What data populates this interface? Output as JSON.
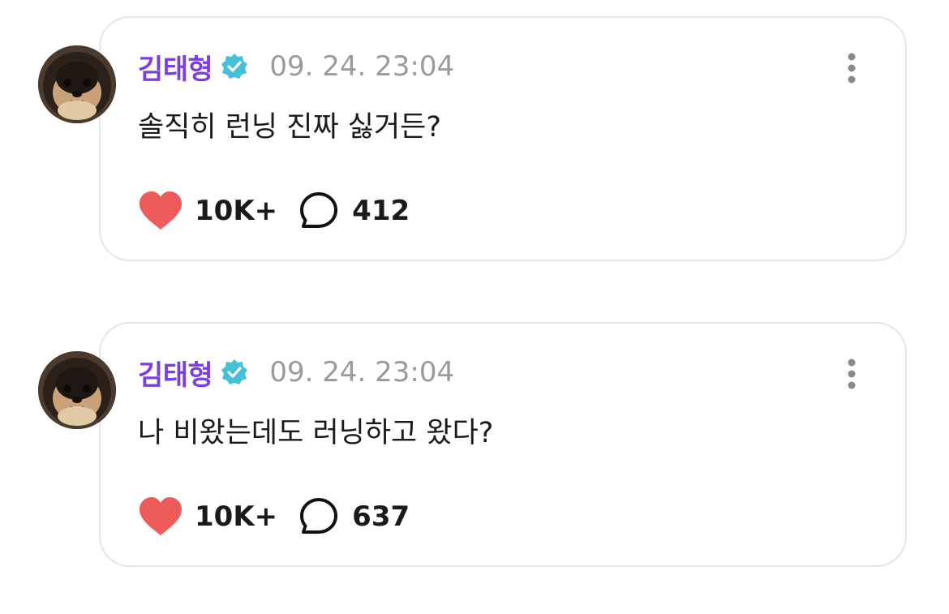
{
  "colors": {
    "author": "#7b3fe0",
    "verified_badge": "#46c0d8",
    "timestamp": "#9a9a9e",
    "heart": "#ee5b5b",
    "card_border": "#e6e6e8"
  },
  "posts": [
    {
      "author": "김태형",
      "verified_icon": "verified-badge-icon",
      "timestamp": "09. 24. 23:04",
      "text": "솔직히 런닝 진짜 싫거든?",
      "likes": "10K+",
      "comments": "412"
    },
    {
      "author": "김태형",
      "verified_icon": "verified-badge-icon",
      "timestamp": "09. 24. 23:04",
      "text": "나 비왔는데도 러닝하고 왔다?",
      "likes": "10K+",
      "comments": "637"
    }
  ]
}
